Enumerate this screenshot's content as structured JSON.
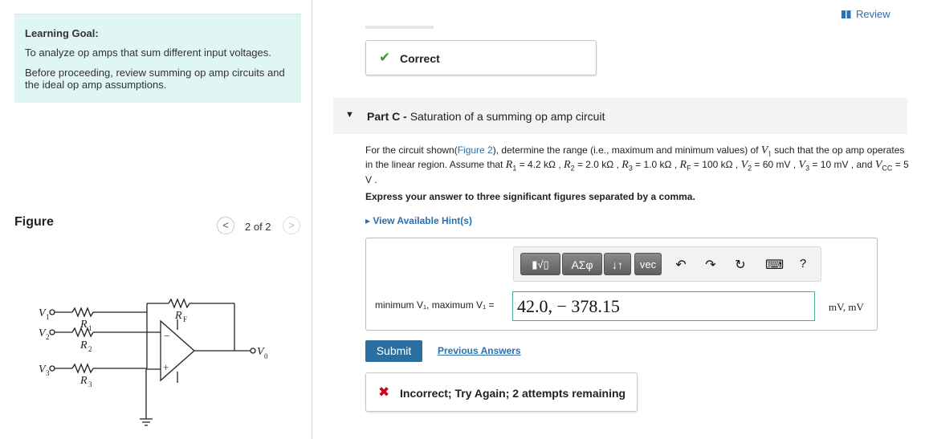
{
  "left": {
    "goal_title": "Learning Goal:",
    "goal_line1": "To analyze op amps that sum different input voltages.",
    "goal_line2": "Before proceeding, review summing op amp circuits and the ideal op amp assumptions.",
    "figure_label": "Figure",
    "figure_count": "2 of 2",
    "prev_glyph": "<",
    "next_glyph": ">",
    "circuit_labels": {
      "v1": "V",
      "v1_sub": "1",
      "v2": "V",
      "v2_sub": "2",
      "v3": "V",
      "v3_sub": "3",
      "r1": "R",
      "r1_sub": "1",
      "r2": "R",
      "r2_sub": "2",
      "r3": "R",
      "r3_sub": "3",
      "rf": "R",
      "rf_sub": "F",
      "vo": "V",
      "vo_sub": "0",
      "minus": "−",
      "plus": "+"
    }
  },
  "right": {
    "review_label": "Review",
    "correct_label": "Correct",
    "part_arrow": "▼",
    "part_prefix": "Part C - ",
    "part_title": "Saturation of a summing op amp circuit",
    "problem": {
      "t1": "For the circuit shown(",
      "fig_link": "Figure 2",
      "t2": "), determine the range (i.e., maximum and minimum values) of ",
      "t3": " such that the op amp operates in the linear region. Assume that ",
      "r1": "R",
      "r1_sub": "1",
      "r1_val": " = 4.2 kΩ , ",
      "r2": "R",
      "r2_sub": "2",
      "r2_val": " = 2.0 kΩ , ",
      "r3": "R",
      "r3_sub": "3",
      "r3_val": " = 1.0 kΩ , ",
      "rf": "R",
      "rf_sub": "F",
      "rf_val": " = 100 kΩ , ",
      "v2": "V",
      "v2_sub": "2",
      "v2_val": " = 60 mV , ",
      "v3": "V",
      "v3_sub": "3",
      "v3_val": " = 10 mV , and ",
      "vcc": "V",
      "vcc_sub": "CC",
      "vcc_val": " = 5 V .",
      "v1": "V",
      "v1_sub": "1"
    },
    "express": "Express your answer to three significant figures separated by a comma.",
    "hints": "▸ View Available Hint(s)",
    "toolbar": {
      "template": "▮√▯",
      "greek": "ΑΣφ",
      "sort": "↓↑",
      "vec": "vec",
      "undo": "↶",
      "redo": "↷",
      "reset": "↻",
      "keyboard": "⌨",
      "help": "?"
    },
    "answer_label": "minimum V₁, maximum V₁ =",
    "answer_value": "42.0, − 378.15",
    "units": "mV, mV",
    "submit": "Submit",
    "previous_answers": "Previous Answers",
    "incorrect_icon": "✖",
    "incorrect_label": "Incorrect; Try Again; 2 attempts remaining"
  }
}
